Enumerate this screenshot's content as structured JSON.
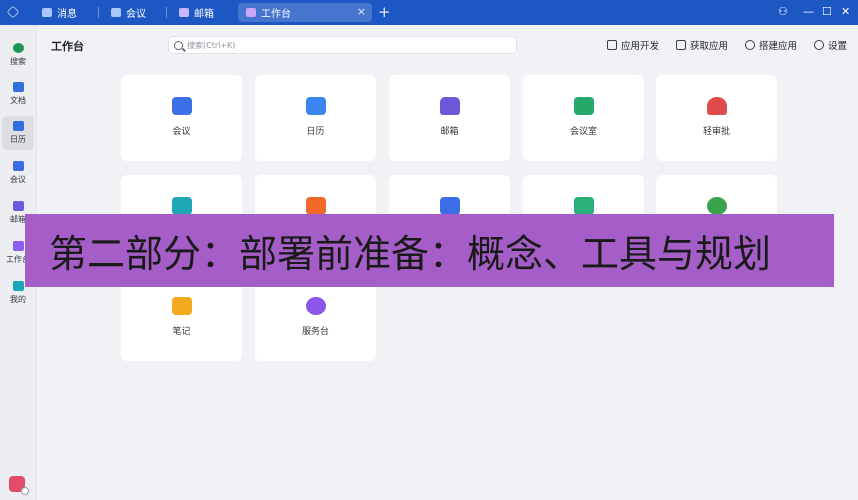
{
  "tabs": [
    {
      "label": "消息",
      "icon": "chat-icon",
      "color": "#ffffff"
    },
    {
      "label": "会议",
      "icon": "video-icon",
      "color": "#ffffff"
    },
    {
      "label": "邮箱",
      "icon": "mail-icon",
      "color": "#ffffff"
    },
    {
      "label": "工作台",
      "icon": "workplace-icon",
      "color": "#c9a6f5",
      "active": true
    }
  ],
  "tab_close": "×",
  "tab_add": "+",
  "window_controls": {
    "minimize": "—",
    "maximize": "☐",
    "close": "✕",
    "extra": "⚇"
  },
  "rail": [
    {
      "label": "搜索",
      "icon": "search-icon",
      "color": "#1c9a55"
    },
    {
      "label": "文档",
      "icon": "doc-icon",
      "color": "#2f6fe0"
    },
    {
      "label": "日历",
      "icon": "calendar-icon",
      "color": "#2f6fe0",
      "active": true
    },
    {
      "label": "会议",
      "icon": "video-icon",
      "color": "#3f6ae8"
    },
    {
      "label": "邮箱",
      "icon": "mail-icon",
      "color": "#6b5be0"
    },
    {
      "label": "工作台",
      "icon": "workplace-icon",
      "color": "#8b5cf0"
    },
    {
      "label": "我的",
      "icon": "cube-icon",
      "color": "#19a6b8"
    }
  ],
  "header": {
    "title": "工作台",
    "search_placeholder": "搜索(Ctrl+K)",
    "actions": [
      "应用开发",
      "获取应用",
      "搭建应用",
      "设置"
    ]
  },
  "apps": [
    {
      "label": "会议",
      "icon": "video-icon",
      "color": "#3c6fe8"
    },
    {
      "label": "日历",
      "icon": "calendar-icon",
      "color": "#3a86f2"
    },
    {
      "label": "邮箱",
      "icon": "mail-icon",
      "color": "#6e57d8"
    },
    {
      "label": "会议室",
      "icon": "meeting-room-icon",
      "color": "#27a86b"
    },
    {
      "label": "轻审批",
      "icon": "stamp-icon",
      "color": "#e04a4a"
    },
    {
      "label": "",
      "icon": "printer-icon",
      "color": "#1fa7b5"
    },
    {
      "label": "",
      "icon": "megaphone-icon",
      "color": "#f0682a"
    },
    {
      "label": "",
      "icon": "edit-icon",
      "color": "#3b6de6"
    },
    {
      "label": "",
      "icon": "check-icon",
      "color": "#2bb07a"
    },
    {
      "label": "",
      "icon": "group-icon",
      "color": "#39a34e"
    },
    {
      "label": "笔记",
      "icon": "note-icon",
      "color": "#f2a91b"
    },
    {
      "label": "服务台",
      "icon": "support-icon",
      "color": "#8a55e8"
    }
  ],
  "banner": {
    "text": "第二部分：部署前准备：概念、工具与规划",
    "background": "#a55dc8"
  }
}
